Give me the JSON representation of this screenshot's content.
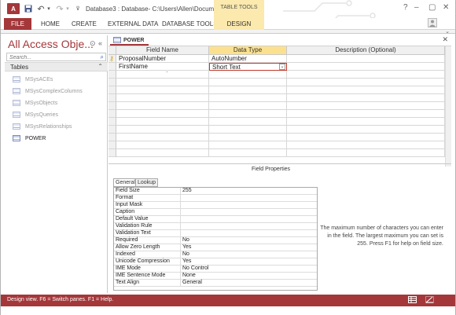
{
  "titlebar": {
    "title": "Database3 : Database- C:\\Users\\Allen\\Document...",
    "context_header": "TABLE TOOLS",
    "app_logo_text": "A",
    "help": "?",
    "restore": "▢",
    "minimize": "–",
    "close": "✕"
  },
  "ribbon": {
    "tabs": [
      "FILE",
      "HOME",
      "CREATE",
      "EXTERNAL DATA",
      "DATABASE TOOLS",
      "DESIGN"
    ]
  },
  "nav": {
    "title": "All Access Obje...",
    "search_placeholder": "Search...",
    "group_label": "Tables",
    "items": [
      {
        "label": "MSysACEs",
        "active": false
      },
      {
        "label": "MSysComplexColumns",
        "active": false
      },
      {
        "label": "MSysObjects",
        "active": false
      },
      {
        "label": "MSysQueries",
        "active": false
      },
      {
        "label": "MSysRelationships",
        "active": false
      },
      {
        "label": "POWER",
        "active": true
      }
    ]
  },
  "document": {
    "tab_label": "POWER"
  },
  "grid": {
    "headers": [
      "Field Name",
      "Data Type",
      "Description (Optional)"
    ],
    "rows": [
      {
        "field_name": "ProposalNumber",
        "data_type": "AutoNumber",
        "description": "",
        "primary_key": true
      },
      {
        "field_name": "FirstName",
        "data_type": "Short Text",
        "description": "",
        "primary_key": false
      }
    ],
    "dot": "·"
  },
  "field_properties": {
    "title": "Field Properties",
    "tabs": [
      "General",
      "Lookup"
    ],
    "rows": [
      {
        "label": "Field Size",
        "value": "255"
      },
      {
        "label": "Format",
        "value": ""
      },
      {
        "label": "Input Mask",
        "value": ""
      },
      {
        "label": "Caption",
        "value": ""
      },
      {
        "label": "Default Value",
        "value": ""
      },
      {
        "label": "Validation Rule",
        "value": ""
      },
      {
        "label": "Validation Text",
        "value": ""
      },
      {
        "label": "Required",
        "value": "No"
      },
      {
        "label": "Allow Zero Length",
        "value": "Yes"
      },
      {
        "label": "Indexed",
        "value": "No"
      },
      {
        "label": "Unicode Compression",
        "value": "Yes"
      },
      {
        "label": "IME Mode",
        "value": "No Control"
      },
      {
        "label": "IME Sentence Mode",
        "value": "None"
      },
      {
        "label": "Text Align",
        "value": "General"
      }
    ],
    "help_text": "The maximum number of characters you can enter in the field. The largest maximum you can set is 255. Press F1 for help on field size."
  },
  "statusbar": {
    "text": "Design view.  F6 = Switch panes.  F1 = Help."
  },
  "colors": {
    "accent": "#a4373a",
    "context_tab": "#fbe9ad"
  }
}
